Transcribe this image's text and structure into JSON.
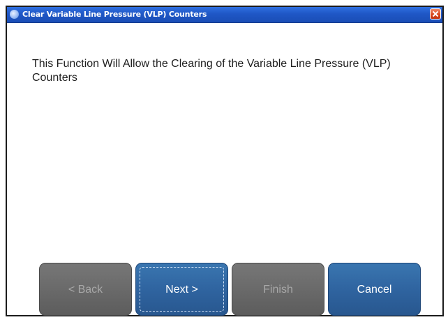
{
  "window": {
    "title": "Clear Variable Line Pressure (VLP) Counters",
    "title_icon": "info-globe-icon",
    "close_icon": "close-icon"
  },
  "content": {
    "message": "This Function Will Allow the Clearing of the Variable Line Pressure (VLP) Counters"
  },
  "buttons": {
    "back": {
      "label": "< Back",
      "enabled": false
    },
    "next": {
      "label": "Next >",
      "enabled": true,
      "focused": true
    },
    "finish": {
      "label": "Finish",
      "enabled": false
    },
    "cancel": {
      "label": "Cancel",
      "enabled": true
    }
  },
  "colors": {
    "titlebar": "#1f57c6",
    "primary_button": "#2f64a0",
    "disabled_button": "#6a6a6a",
    "close_button": "#d9481f"
  }
}
